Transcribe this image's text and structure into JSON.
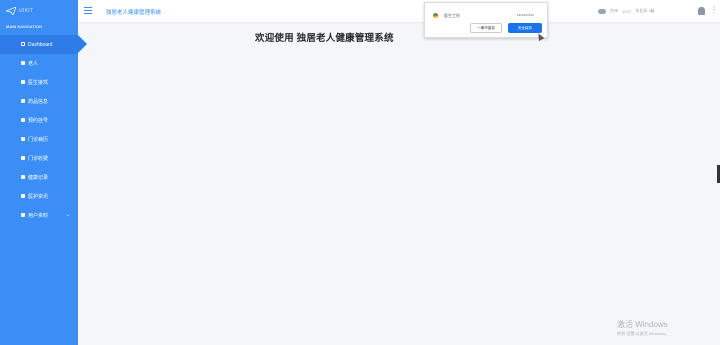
{
  "sidebar": {
    "logo_text": "UIKIT",
    "nav_header": "MAIN NAVIGATION",
    "items": [
      {
        "label": "Dashboard"
      },
      {
        "label": "老人"
      },
      {
        "label": "医生接驾"
      },
      {
        "label": "药品信息"
      },
      {
        "label": "预约挂号"
      },
      {
        "label": "门诊病历"
      },
      {
        "label": "门诊收费"
      },
      {
        "label": "健康记录"
      },
      {
        "label": "医护资讯"
      },
      {
        "label": "用户资料"
      }
    ]
  },
  "header": {
    "title": "独居老人健康管理系统",
    "weather": {
      "location": "台州",
      "temp": "12.0°",
      "condition": "东北风 3级"
    }
  },
  "main": {
    "welcome": "欢迎使用 独居老人健康管理系统"
  },
  "password_popup": {
    "site": "医生工作",
    "password_mask": "••••••••••",
    "never_label": "一律不保存",
    "save_label": "安全保存"
  },
  "watermark": {
    "title": "激活 Windows",
    "subtitle": "转到“设置”以激活 Windows。"
  }
}
